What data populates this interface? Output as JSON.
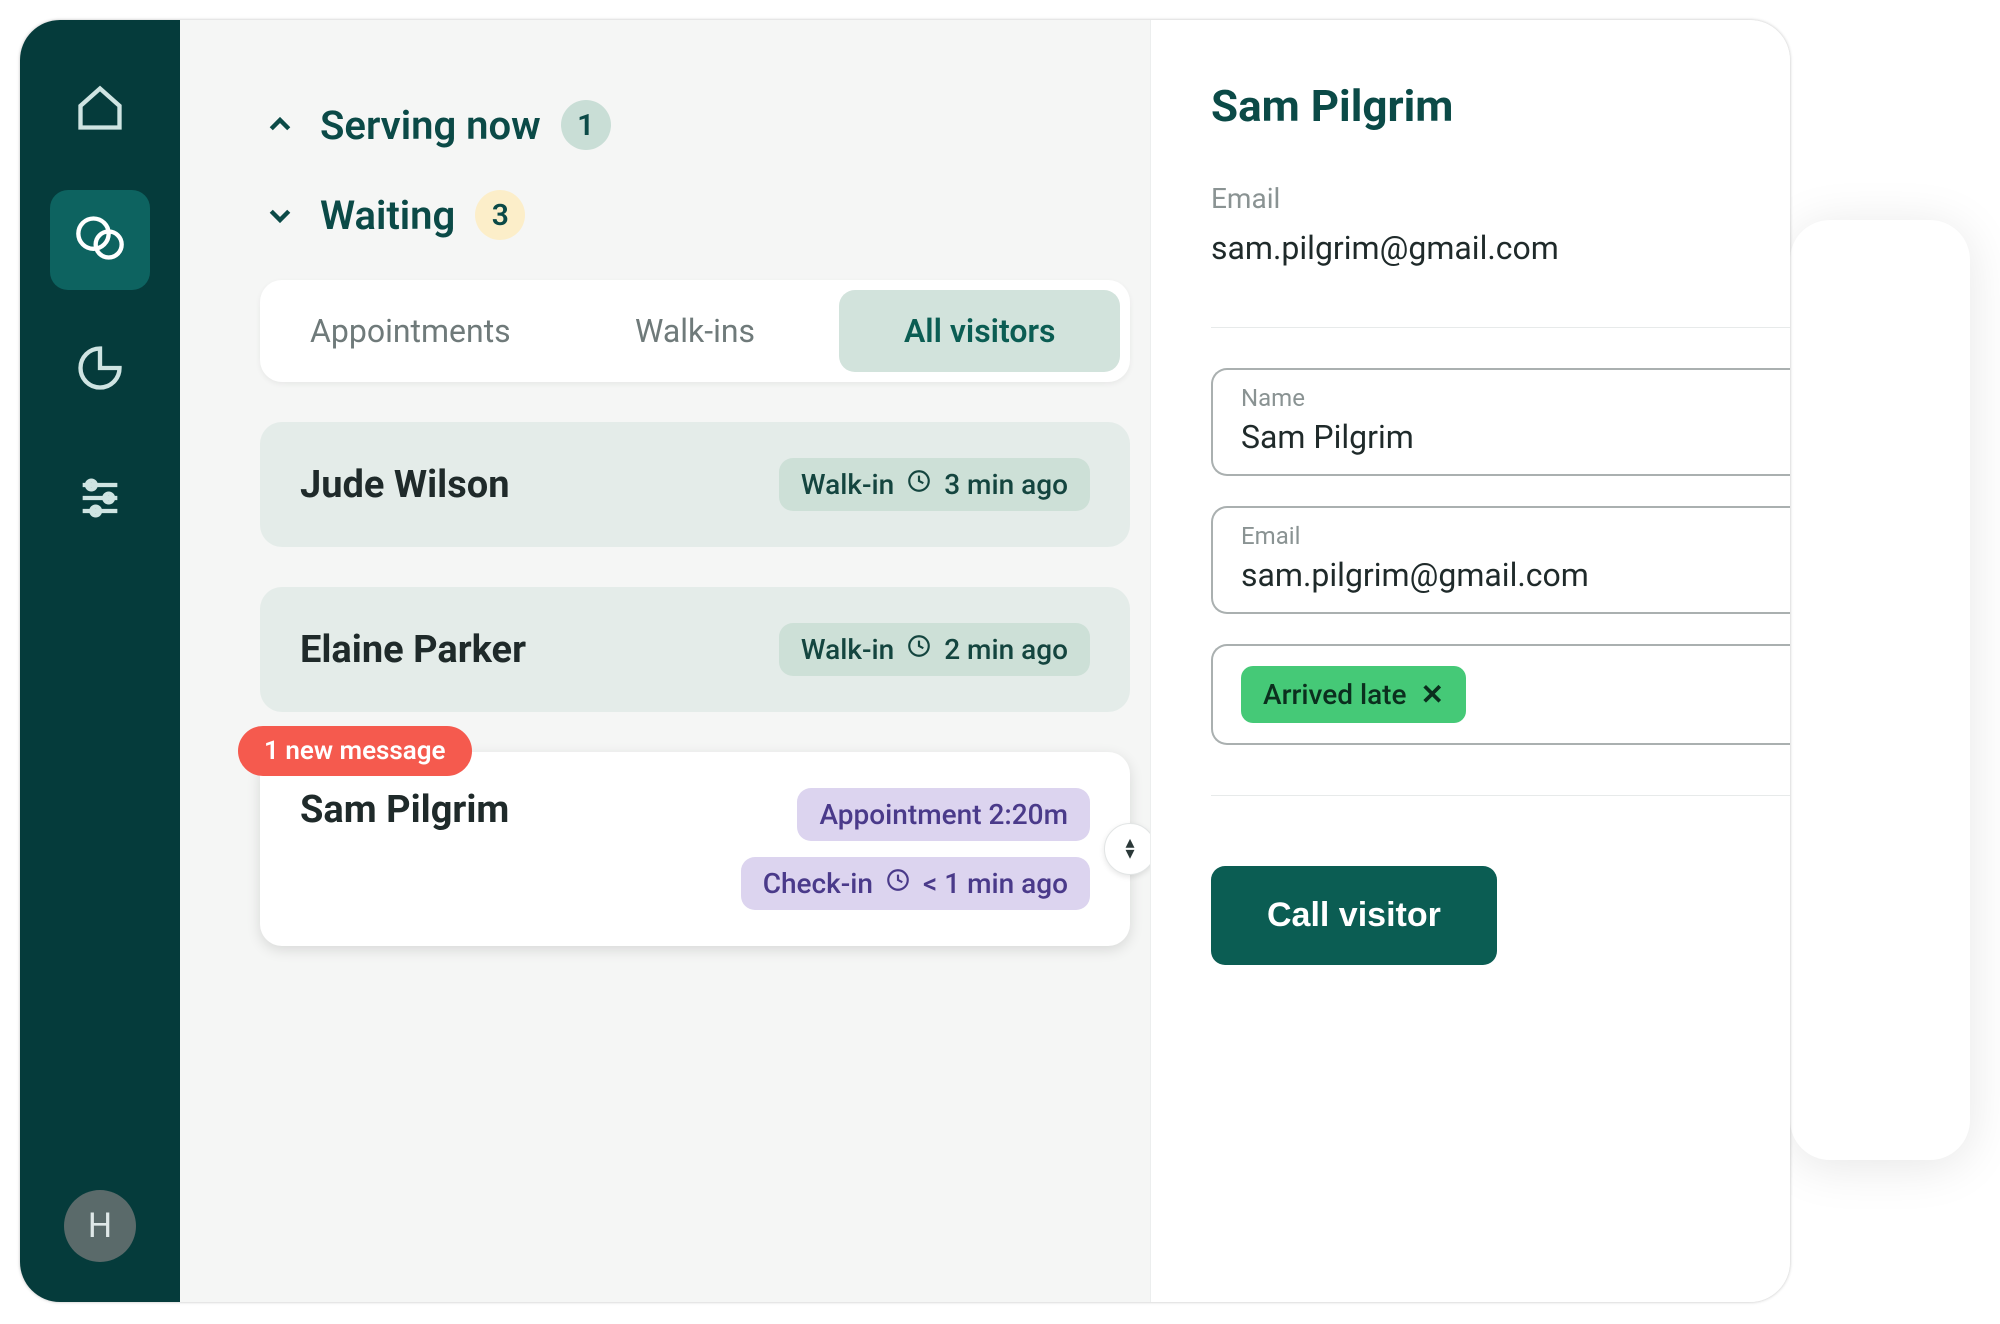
{
  "sidebar": {
    "avatar_initial": "H"
  },
  "sections": {
    "serving": {
      "label": "Serving now",
      "count": "1"
    },
    "waiting": {
      "label": "Waiting",
      "count": "3"
    }
  },
  "tabs": {
    "appointments": "Appointments",
    "walkins": "Walk-ins",
    "all": "All visitors"
  },
  "visitors": [
    {
      "name": "Jude Wilson",
      "type": "Walk-in",
      "time": "3 min ago"
    },
    {
      "name": "Elaine Parker",
      "type": "Walk-in",
      "time": "2 min ago"
    }
  ],
  "selected_visitor": {
    "name": "Sam Pilgrim",
    "new_message": "1 new message",
    "appointment_chip": "Appointment 2:20m",
    "checkin_label": "Check-in",
    "checkin_time": "< 1 min ago"
  },
  "detail": {
    "title": "Sam Pilgrim",
    "email_label": "Email",
    "email_value": "sam.pilgrim@gmail.com",
    "name_field_label": "Name",
    "name_field_value": "Sam Pilgrim",
    "email_field_label": "Email",
    "email_field_value": "sam.pilgrim@gmail.com",
    "tag": "Arrived late",
    "call_button": "Call visitor"
  }
}
